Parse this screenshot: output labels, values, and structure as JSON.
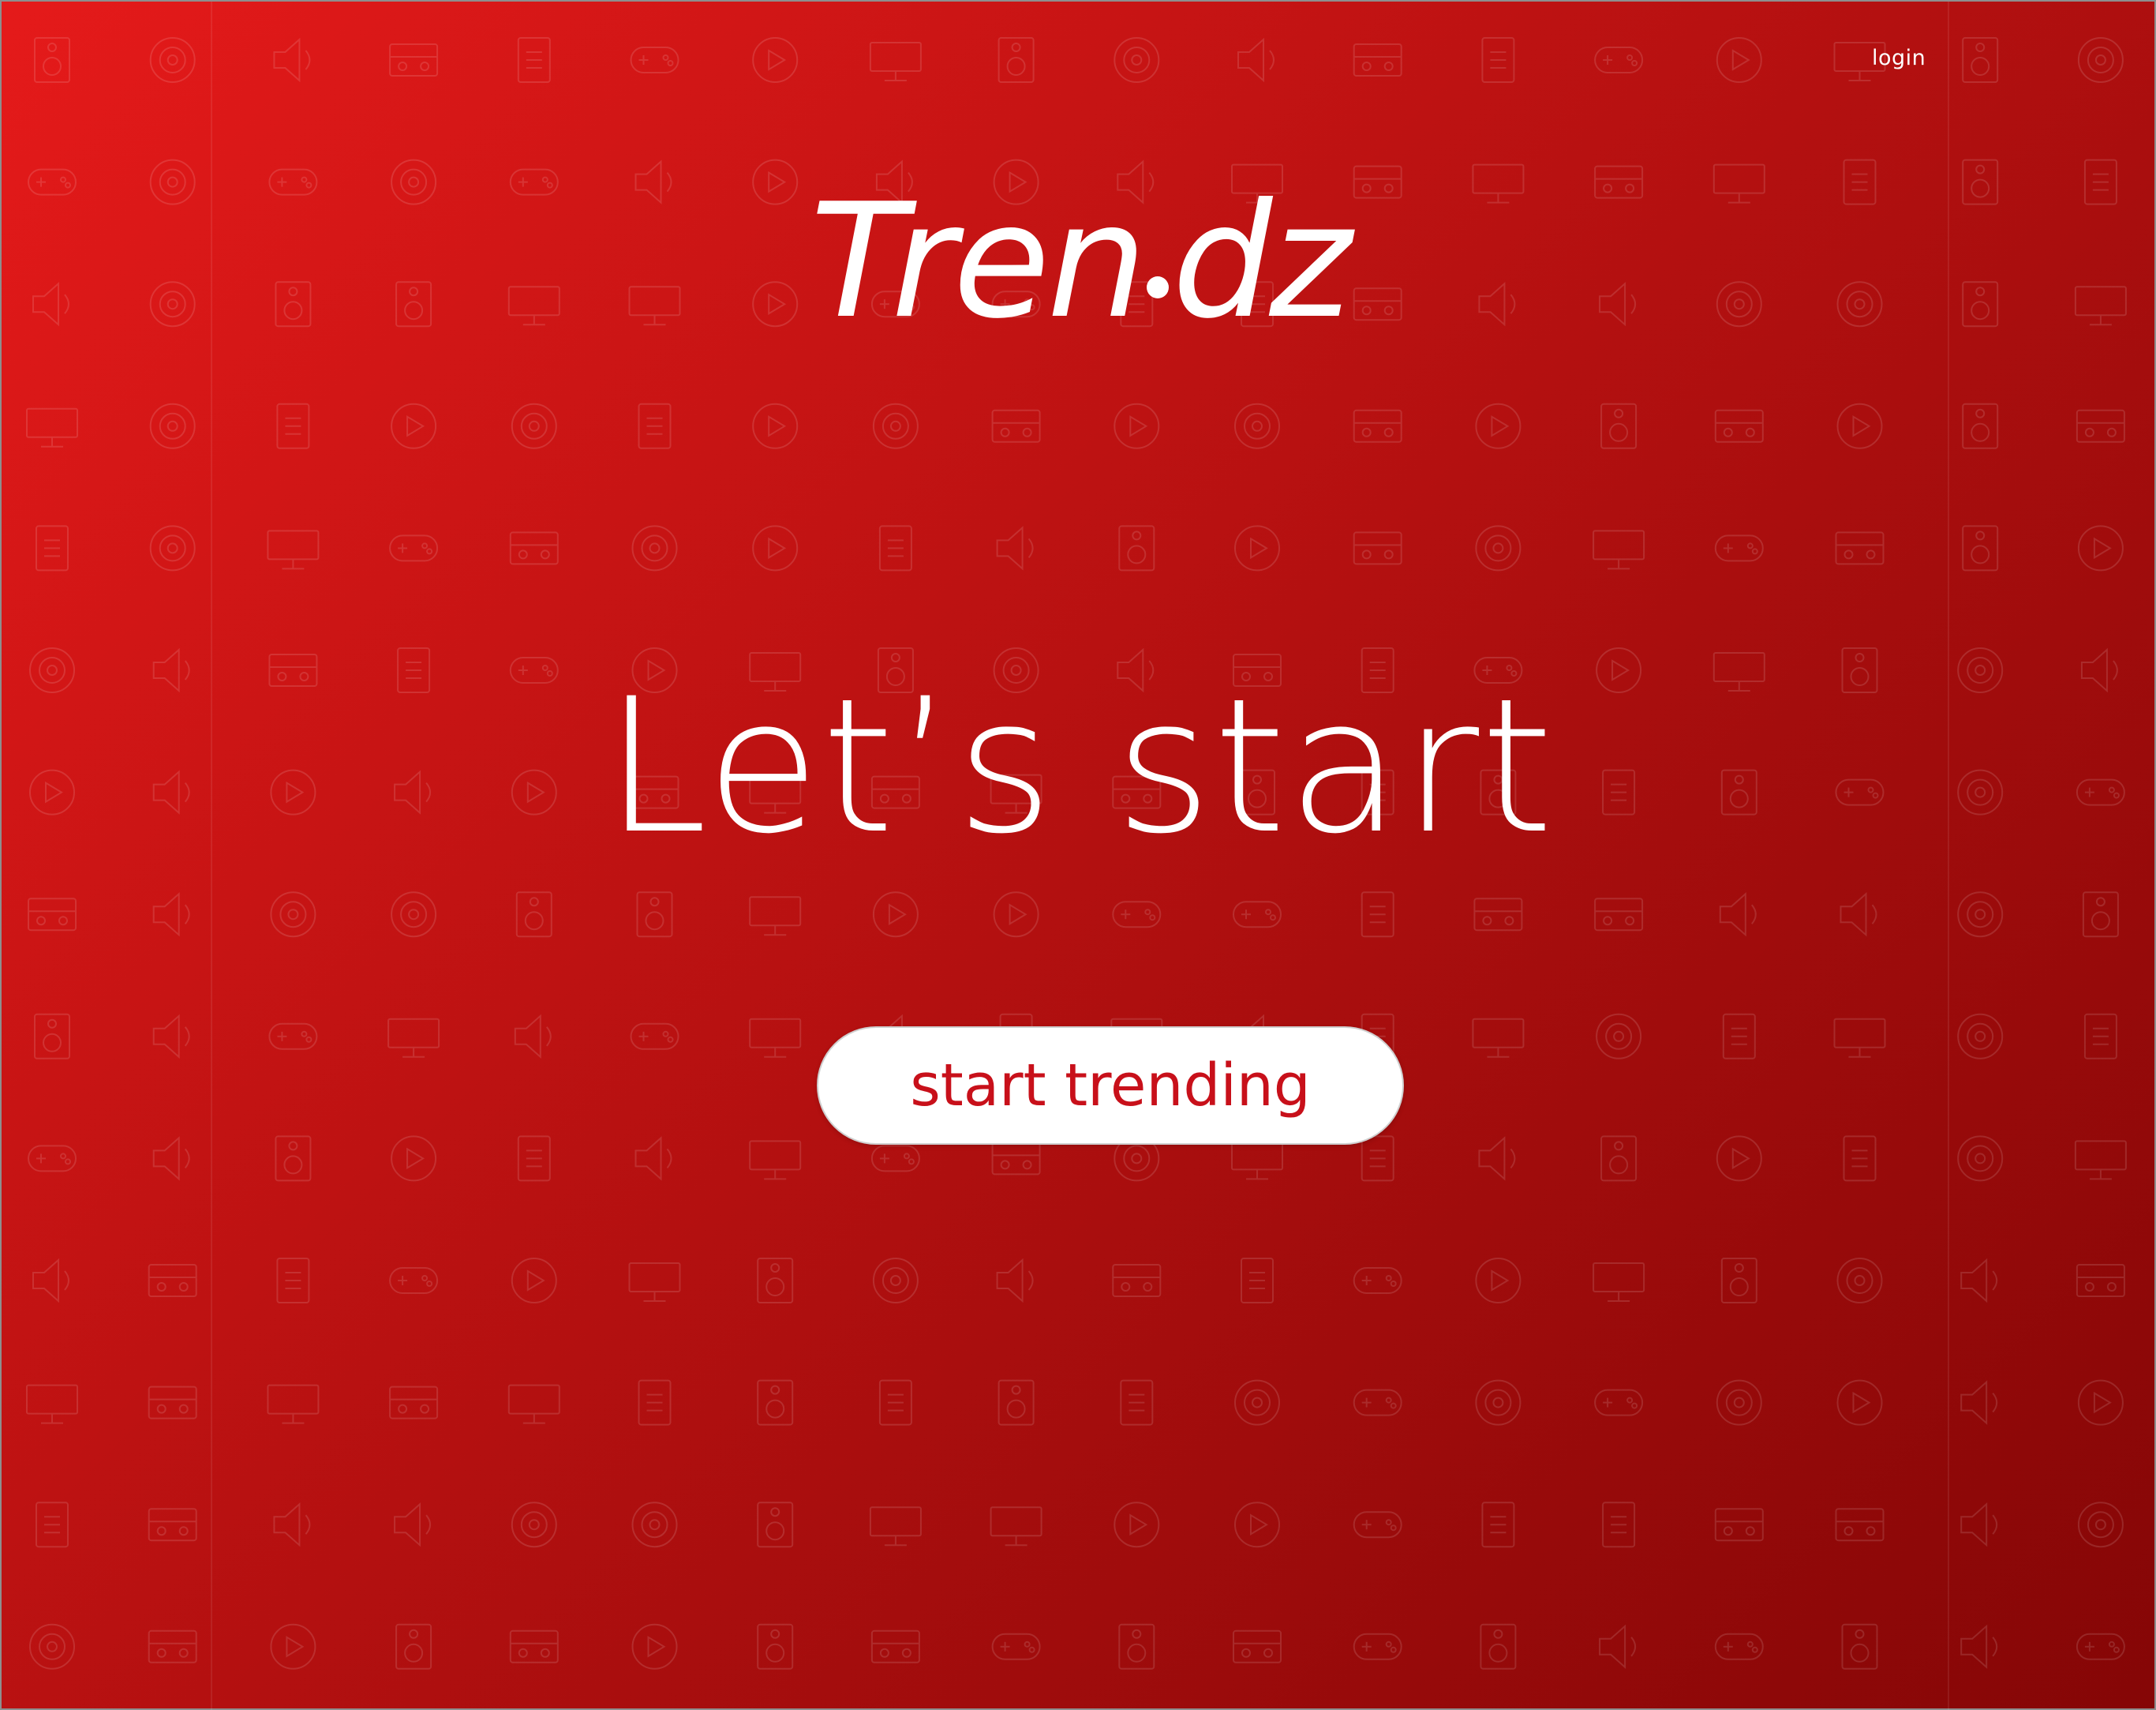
{
  "header": {
    "login_label": "login"
  },
  "hero": {
    "logo_part1": "Tren",
    "logo_part2": "dz",
    "headline": "Let’s start",
    "cta_label": "start trending"
  },
  "theme": {
    "accent": "#c8101a",
    "background_start": "#e51a1a",
    "background_end": "#850606",
    "text": "#ffffff"
  },
  "background_pattern": {
    "icons": [
      "speaker-icon",
      "microphone-icon",
      "volume-icon",
      "mute-icon",
      "tv-icon",
      "remote-icon",
      "printer-icon",
      "radio-icon",
      "laptop-icon",
      "camera-icon",
      "monitor-icon",
      "gamepad-icon",
      "pause-icon",
      "rewind-icon",
      "fast-forward-icon",
      "play-icon",
      "stop-icon",
      "power-icon",
      "music-note-icon",
      "battery-icon",
      "cassette-icon",
      "film-reel-icon",
      "clapperboard-icon",
      "vinyl-disc-icon",
      "headphones-icon",
      "floppy-disk-icon",
      "zoom-in-icon",
      "zoom-out-icon",
      "satellite-icon",
      "at-sign-icon",
      "star-icon",
      "joystick-icon"
    ]
  }
}
